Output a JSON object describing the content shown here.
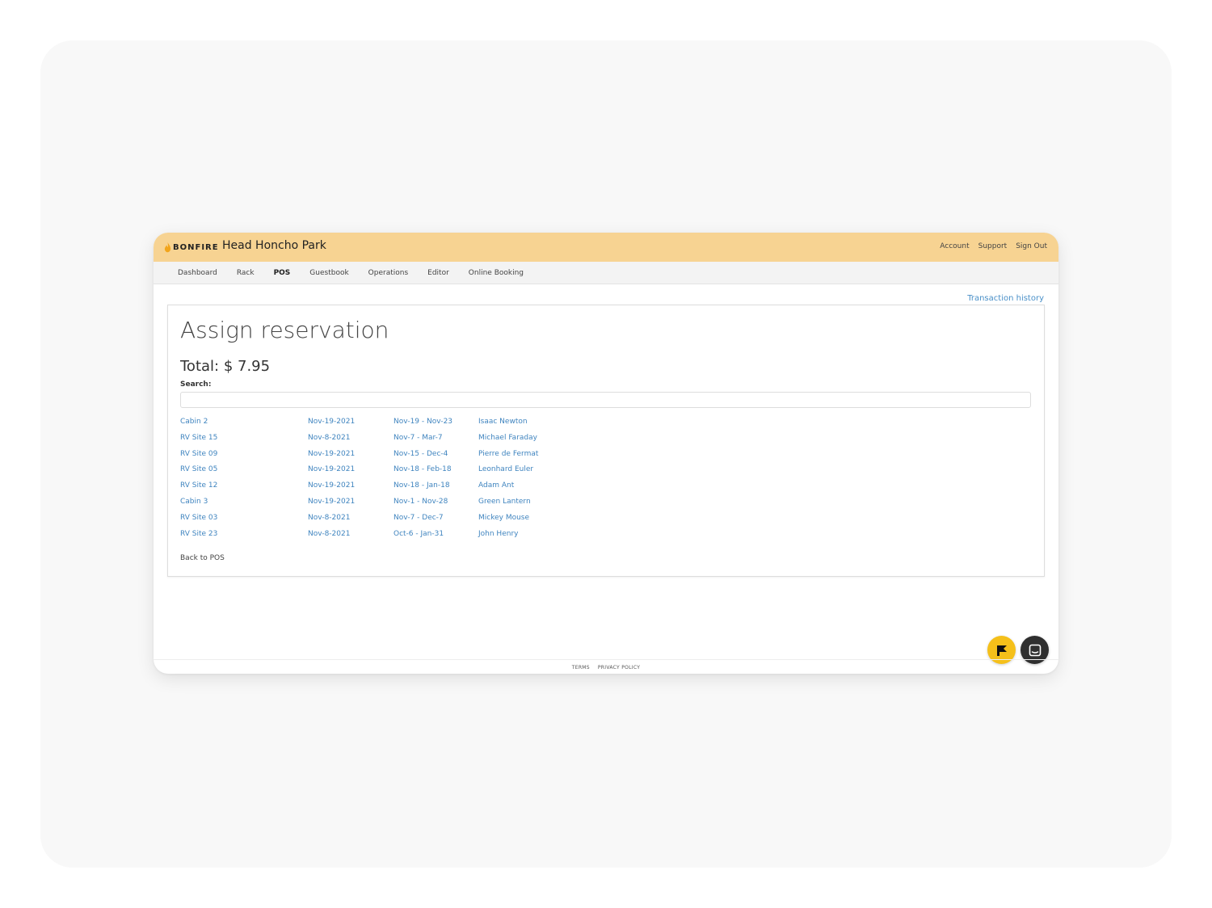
{
  "app": {
    "logo_text": "BONFIRE",
    "park_name": "Head Honcho Park",
    "brand_color": "#f7d392"
  },
  "top_links": [
    "Account",
    "Support",
    "Sign Out"
  ],
  "nav": {
    "items": [
      "Dashboard",
      "Rack",
      "POS",
      "Guestbook",
      "Operations",
      "Editor",
      "Online Booking"
    ],
    "active": "POS"
  },
  "transaction_history": "Transaction history",
  "page": {
    "title": "Assign reservation",
    "total": "Total: $ 7.95",
    "search_label": "Search:",
    "search_value": "",
    "search_placeholder": ""
  },
  "reservations": [
    {
      "site": "Cabin 2",
      "date": "Nov-19-2021",
      "range": "Nov-19 - Nov-23",
      "guest": "Isaac Newton"
    },
    {
      "site": "RV Site 15",
      "date": "Nov-8-2021",
      "range": "Nov-7 - Mar-7",
      "guest": "Michael Faraday"
    },
    {
      "site": "RV Site 09",
      "date": "Nov-19-2021",
      "range": "Nov-15 - Dec-4",
      "guest": "Pierre de Fermat"
    },
    {
      "site": "RV Site 05",
      "date": "Nov-19-2021",
      "range": "Nov-18 - Feb-18",
      "guest": "Leonhard Euler"
    },
    {
      "site": "RV Site 12",
      "date": "Nov-19-2021",
      "range": "Nov-18 - Jan-18",
      "guest": "Adam Ant"
    },
    {
      "site": "Cabin 3",
      "date": "Nov-19-2021",
      "range": "Nov-1 - Nov-28",
      "guest": "Green Lantern"
    },
    {
      "site": "RV Site 03",
      "date": "Nov-8-2021",
      "range": "Nov-7 - Dec-7",
      "guest": "Mickey Mouse"
    },
    {
      "site": "RV Site 23",
      "date": "Nov-8-2021",
      "range": "Oct-6 - Jan-31",
      "guest": "John Henry"
    }
  ],
  "back_link": "Back to POS",
  "footer": [
    "TERMS",
    "PRIVACY POLICY"
  ],
  "fabs": {
    "left_icon": "flag-icon",
    "left_color": "#f5c01a",
    "right_icon": "chat-icon",
    "right_color": "#2f2f2f"
  }
}
